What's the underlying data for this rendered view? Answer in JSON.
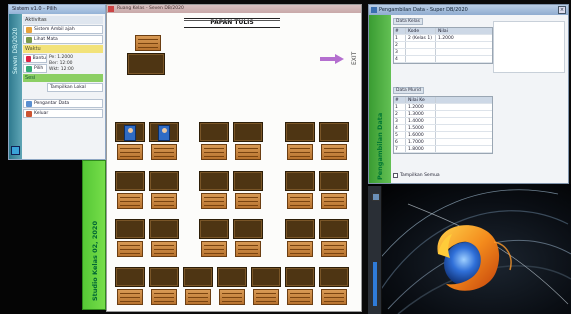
{
  "left_window": {
    "title": "Sistem v1.0 - Pilih",
    "strip_label": "Seven DB/2020",
    "group1_title": "Aktivitas",
    "btn1": "Sistem Ambil ajah",
    "btn2": "Lihat Mata",
    "group2_title": "Waktu",
    "btn3": "Bantu",
    "btn4": "Pilih",
    "kv1": "Pe: 1.2000",
    "kv2": "Ber: 12:00",
    "kv3": "Wkt: 12:00",
    "group3_title": "Sesi",
    "btn5": "Tampilkan Lokal",
    "btn6": "Pengantar Data",
    "btn7": "Keluar"
  },
  "center_window": {
    "title": "Ruang Kelas - Seven DB/2020",
    "board_label": "PAPAN TULIS",
    "exit_label": "EXIT",
    "strip_label": "Studio Kelas 02, 2020"
  },
  "right_window": {
    "title": "Pengambilan Data - Super DB/2020",
    "strip_label": "Pengambilan Data",
    "group1_label": "Data Kelas",
    "table1_header": [
      "#",
      "Kode",
      "Nilai"
    ],
    "table1_rows": [
      [
        "1",
        "2 (Kelas 1)",
        "1.2000"
      ],
      [
        "2",
        "",
        ""
      ],
      [
        "3",
        "",
        ""
      ],
      [
        "4",
        "",
        ""
      ]
    ],
    "group2_label": "Data Murid",
    "table2_header": [
      "#",
      "Nilai Ke",
      ""
    ],
    "table2_rows": [
      [
        "1",
        "1.2000",
        ""
      ],
      [
        "2",
        "1.3000",
        ""
      ],
      [
        "3",
        "1.4000",
        ""
      ],
      [
        "4",
        "1.5000",
        ""
      ],
      [
        "5",
        "1.6000",
        ""
      ],
      [
        "6",
        "1.7000",
        ""
      ],
      [
        "7",
        "1.8000",
        ""
      ]
    ],
    "checkbox_label": "Tampilkan Semua"
  }
}
